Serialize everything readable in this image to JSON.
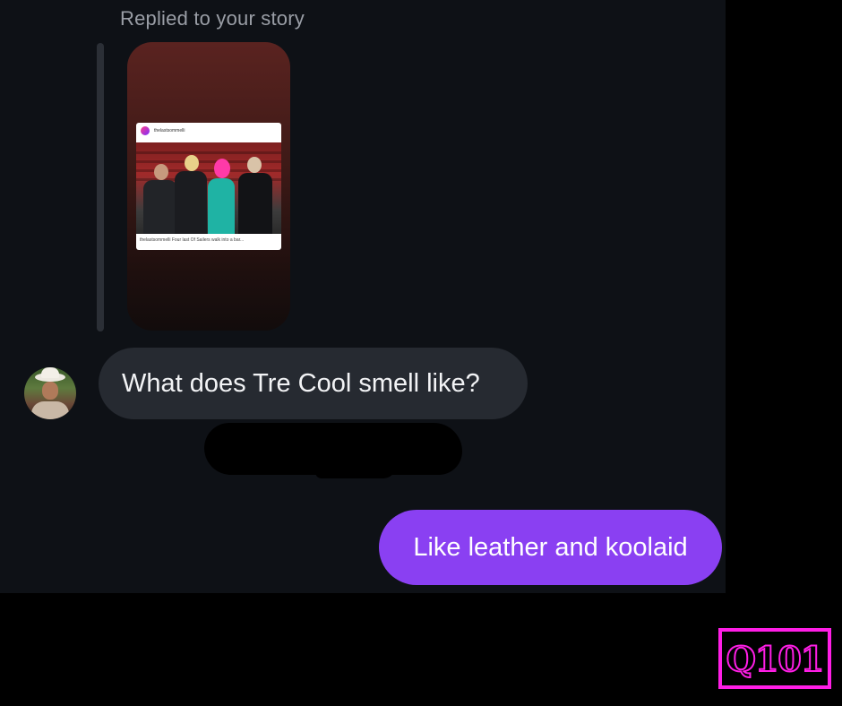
{
  "thread": {
    "reply_label": "Replied to your story",
    "story": {
      "post_username": "thelastsommelli",
      "post_caption": "thelastsommelli Four last Of Sailers walk into a bar..."
    },
    "incoming_message": "What does Tre Cool smell like?",
    "outgoing_message": "Like leather and koolaid"
  },
  "branding": {
    "logo_text": "Q101",
    "logo_color": "#ff1ee6"
  },
  "colors": {
    "chat_background": "#0e1116",
    "incoming_bubble": "#262a31",
    "outgoing_bubble": "#8a40f2",
    "label_text": "#9a9ea6"
  }
}
